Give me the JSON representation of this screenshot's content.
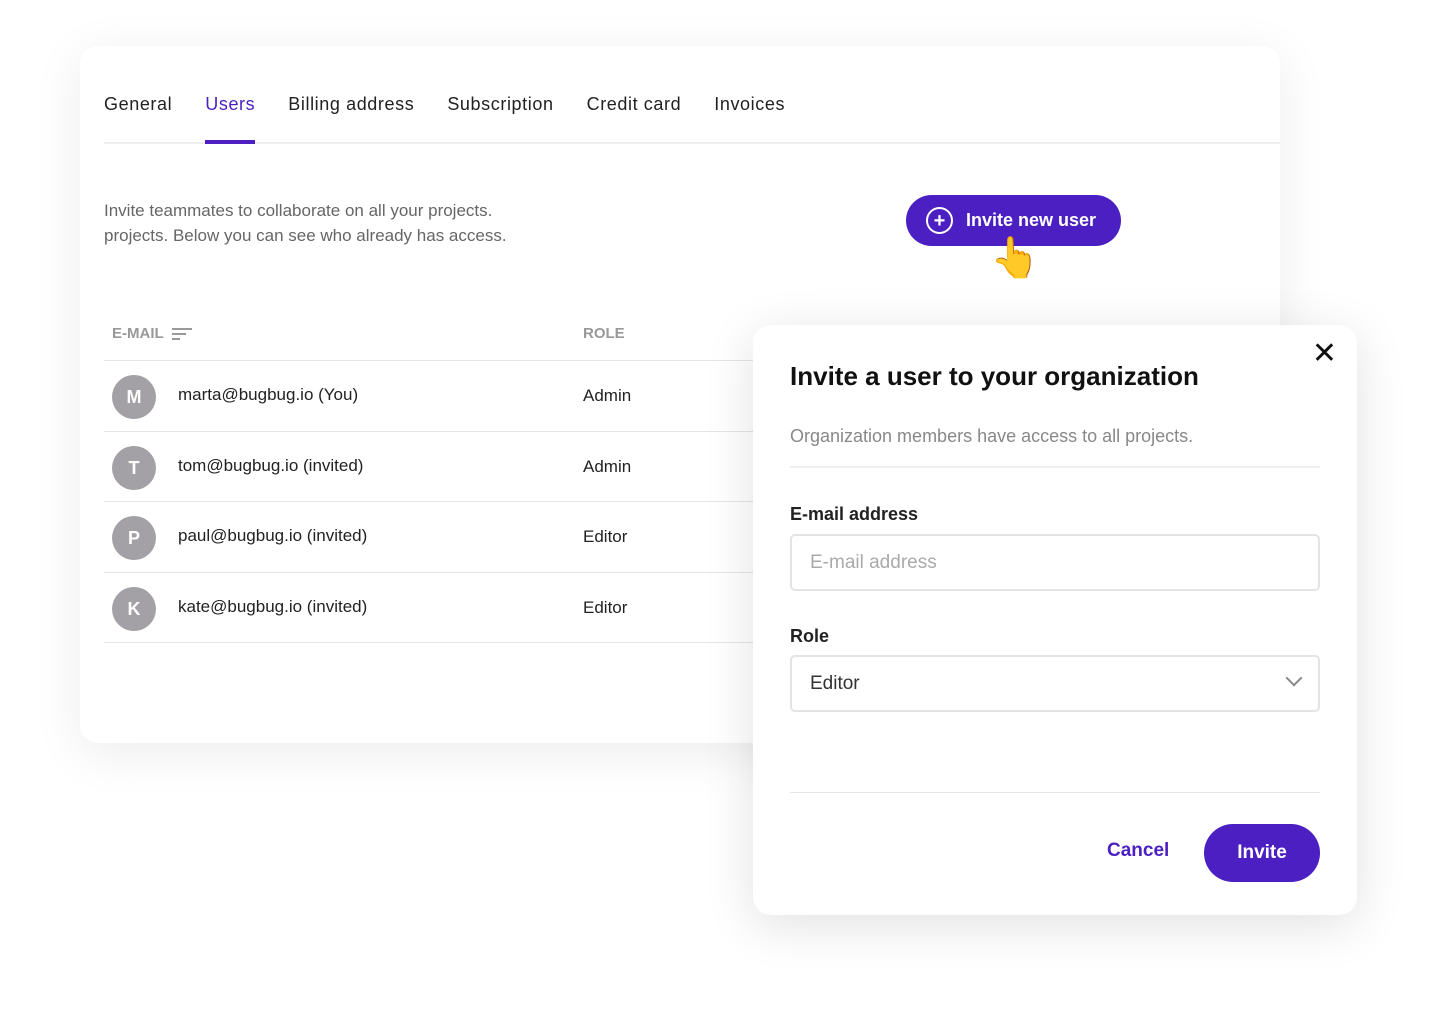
{
  "tabs": [
    "General",
    "Users",
    "Billing address",
    "Subscription",
    "Credit card",
    "Invoices"
  ],
  "active_tab": "Users",
  "description": [
    "Invite teammates to collaborate on all your projects.",
    "projects. Below you can see who already has access."
  ],
  "invite_new_user_label": "Invite new user",
  "table": {
    "headers": {
      "email": "E-MAIL",
      "role": "ROLE"
    },
    "rows": [
      {
        "initial": "M",
        "email": "marta@bugbug.io (You)",
        "role": "Admin"
      },
      {
        "initial": "T",
        "email": "tom@bugbug.io (invited)",
        "role": "Admin"
      },
      {
        "initial": "P",
        "email": "paul@bugbug.io (invited)",
        "role": "Editor"
      },
      {
        "initial": "K",
        "email": "kate@bugbug.io (invited)",
        "role": "Editor"
      }
    ]
  },
  "modal": {
    "title": "Invite a user to your organization",
    "subtitle": "Organization members have access to all projects.",
    "email_label": "E-mail address",
    "email_placeholder": "E-mail address",
    "email_value": "",
    "role_label": "Role",
    "role_value": "Editor",
    "cancel": "Cancel",
    "invite": "Invite",
    "close_icon": "close-icon"
  },
  "colors": {
    "accent": "#4b1fc1",
    "avatar": "#a3a1a5"
  }
}
